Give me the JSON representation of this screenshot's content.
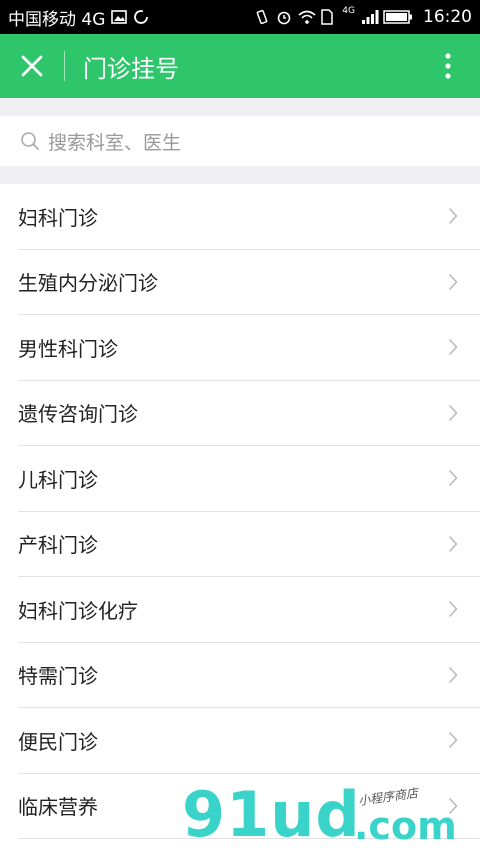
{
  "status_bar": {
    "carrier": "中国移动 4G",
    "network_label": "4G",
    "time": "16:20"
  },
  "app_bar": {
    "title": "门诊挂号",
    "close_icon": "close-icon",
    "more_icon": "more-vertical-icon",
    "color": "#2ec56b"
  },
  "search": {
    "placeholder": "搜索科室、医生",
    "icon": "search-icon"
  },
  "departments": [
    {
      "label": "妇科门诊"
    },
    {
      "label": "生殖内分泌门诊"
    },
    {
      "label": "男性科门诊"
    },
    {
      "label": "遗传咨询门诊"
    },
    {
      "label": "儿科门诊"
    },
    {
      "label": "产科门诊"
    },
    {
      "label": "妇科门诊化疗"
    },
    {
      "label": "特需门诊"
    },
    {
      "label": "便民门诊"
    },
    {
      "label": "临床营养"
    }
  ],
  "watermark": {
    "brand": "91ud",
    "suffix": ".com",
    "tagline": "小程序商店"
  }
}
